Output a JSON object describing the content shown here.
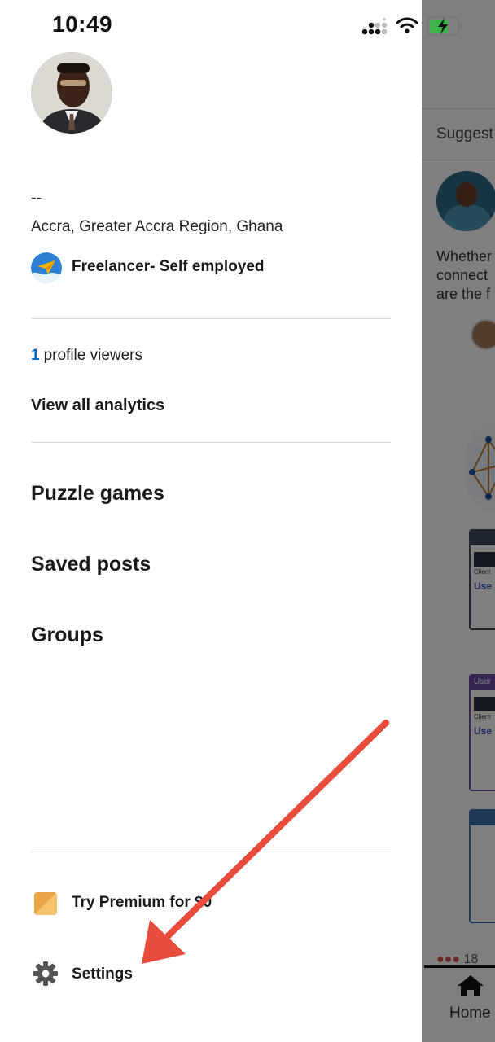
{
  "status_bar": {
    "time": "10:49",
    "icons": [
      "cellular-signal-icon",
      "wifi-icon",
      "battery-charging-icon"
    ]
  },
  "profile": {
    "headline": "--",
    "location": "Accra, Greater Accra Region, Ghana",
    "company": "Freelancer- Self employed",
    "company_logo_icon": "paper-plane-logo-icon"
  },
  "analytics": {
    "viewer_count": "1",
    "viewer_label": "profile viewers",
    "view_all_label": "View all analytics"
  },
  "menu": {
    "items": [
      {
        "label": "Puzzle games"
      },
      {
        "label": "Saved posts"
      },
      {
        "label": "Groups"
      }
    ]
  },
  "footer": {
    "premium_label": "Try Premium for $0",
    "settings_label": "Settings",
    "settings_icon": "gear-icon"
  },
  "background_feed": {
    "suggested_label": "Suggest",
    "post_text_lines": [
      "Whether",
      "connect",
      "are the f"
    ],
    "reaction_count": "18",
    "nav_home_label": "Home",
    "card_caption": "User",
    "card_client_label": "Client",
    "card_use_label": "Use"
  },
  "colors": {
    "accent_blue": "#0a66c2",
    "premium_gold": "#e8a445",
    "arrow_red": "#e74c3c",
    "scrim": "rgba(0,0,0,0.5)"
  }
}
